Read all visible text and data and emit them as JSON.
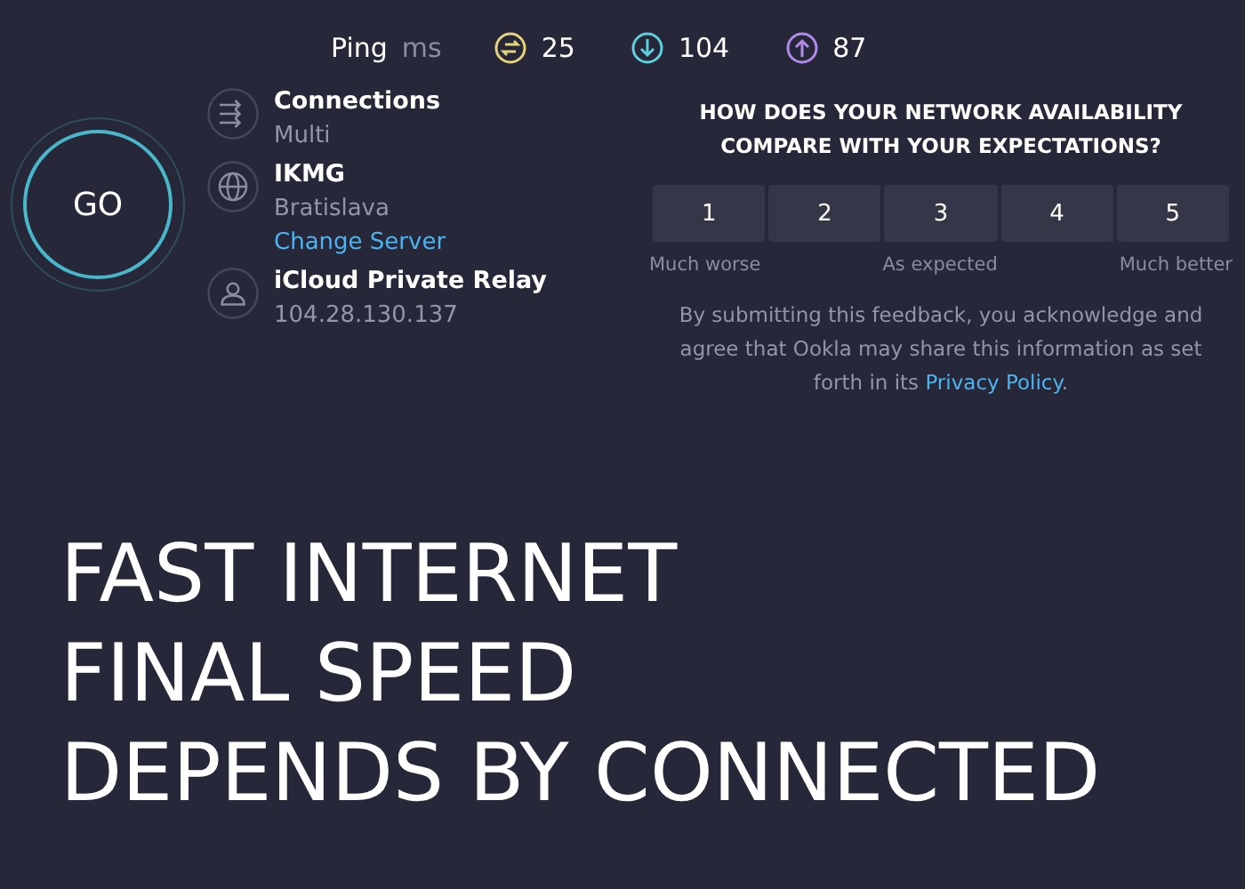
{
  "ping": {
    "label": "Ping",
    "unit": "ms",
    "metrics": [
      {
        "kind": "jitter",
        "value": "25"
      },
      {
        "kind": "download",
        "value": "104"
      },
      {
        "kind": "upload",
        "value": "87"
      }
    ]
  },
  "go_button": {
    "label": "GO"
  },
  "info": [
    {
      "kind": "connections",
      "title": "Connections",
      "lines": [
        "Multi"
      ]
    },
    {
      "kind": "server",
      "title": "IKMG",
      "lines": [
        "Bratislava"
      ],
      "link": "Change Server"
    },
    {
      "kind": "user",
      "title": "iCloud Private Relay",
      "lines": [
        "104.28.130.137"
      ]
    }
  ],
  "survey": {
    "question": "HOW DOES YOUR NETWORK AVAILABILITY COMPARE WITH YOUR EXPECTATIONS?",
    "options": [
      {
        "label": "1",
        "selected": false
      },
      {
        "label": "2",
        "selected": false
      },
      {
        "label": "3",
        "selected": false
      },
      {
        "label": "4",
        "selected": false
      },
      {
        "label": "5",
        "selected": false
      }
    ],
    "scale_labels": [
      "Much worse",
      "As expected",
      "Much better"
    ],
    "disclaimer": "By submitting this feedback, you acknowledge and agree that Ookla may share this information as set forth in its",
    "link": "Privacy Policy",
    "disclaimer_end": "."
  },
  "caption": [
    "FAST INTERNET",
    "FINAL SPEED",
    "DEPENDS BY CONNECTED"
  ]
}
